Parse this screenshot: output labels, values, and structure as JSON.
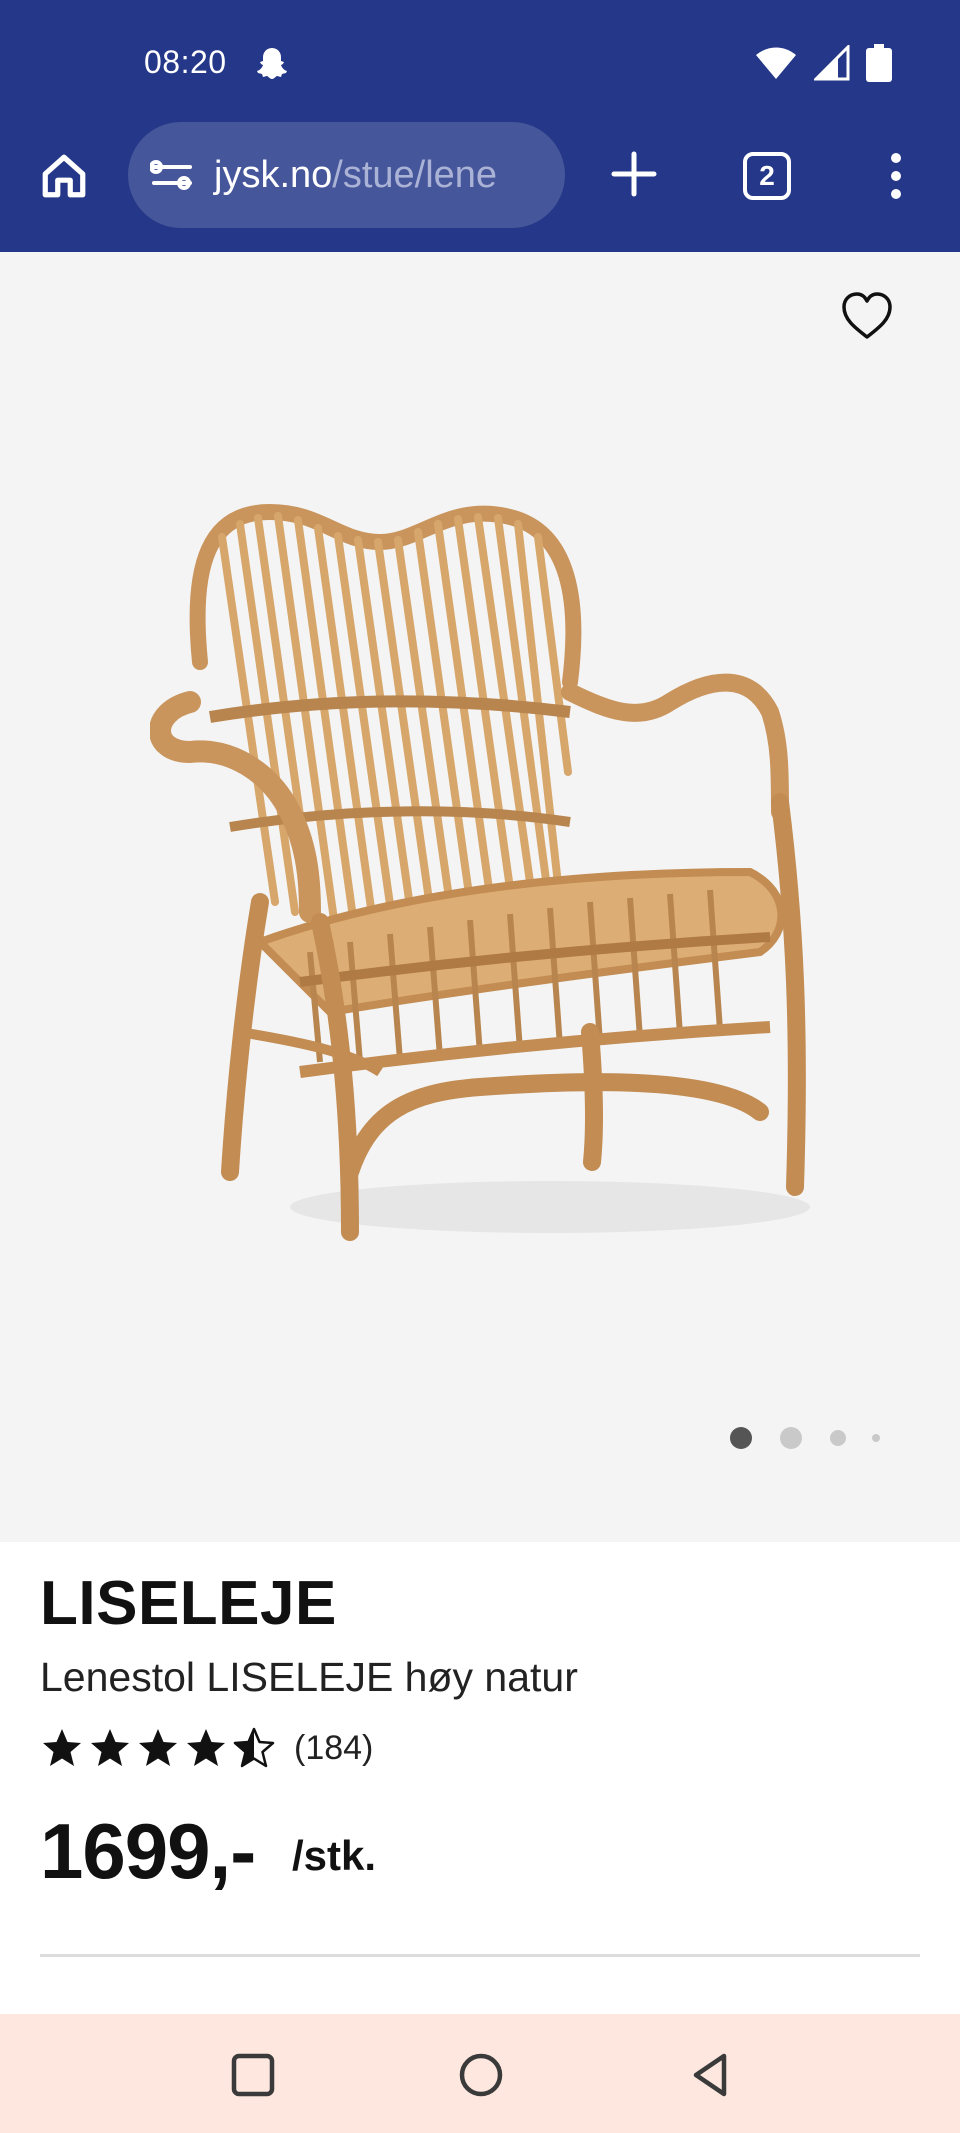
{
  "status_bar": {
    "time": "08:20",
    "icons": [
      "snapchat-ghost-icon",
      "wifi-icon",
      "signal-icon",
      "battery-icon"
    ]
  },
  "browser": {
    "url_domain": "jysk.no",
    "url_path": "/stue/lene",
    "tab_count": "2",
    "toolbar_color": "#243788"
  },
  "product": {
    "brand": "LISELEJE",
    "name": "Lenestol LISELEJE høy natur",
    "rating": 4.5,
    "rating_max": 5,
    "review_count": "(184)",
    "price": "1699,-",
    "unit": "/stk.",
    "image_count": 4,
    "active_image": 1
  },
  "navbar": {
    "buttons": [
      "recents-button",
      "home-button",
      "back-button"
    ],
    "background": "#fde7df"
  }
}
